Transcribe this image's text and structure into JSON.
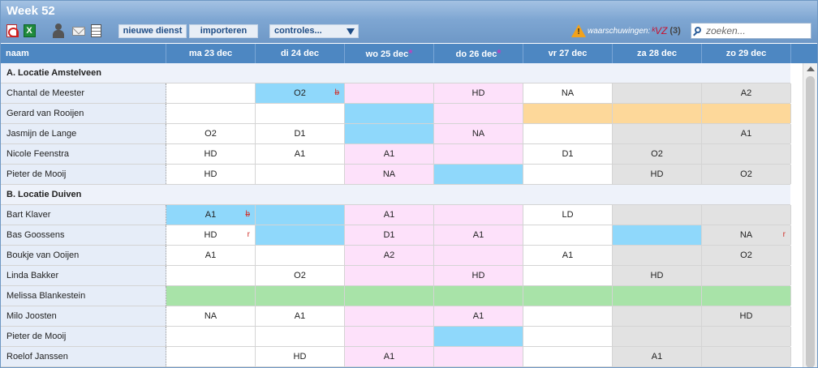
{
  "toolbar": {
    "title": "Week 52",
    "xls_letter": "X",
    "new_shift_label": "nieuwe dienst",
    "import_label": "importeren",
    "checks_label": "controles...",
    "warn_exclamation": "!",
    "warnings_label": "waarschuwingen:",
    "warnings_vz": "ᵏVZ",
    "warnings_count": "(3)",
    "search_placeholder": "zoeken..."
  },
  "colors": {
    "header": "#4d87c2",
    "blue": "#8fd8fb",
    "pink": "#fde1fa",
    "gray": "#e2e2e2",
    "orange": "#fdd89a",
    "green": "#a8e3a8",
    "section_bg": "#eef2fa"
  },
  "columns": {
    "name": "naam",
    "days": [
      {
        "label": "ma 23 dec",
        "star": ""
      },
      {
        "label": "di 24 dec",
        "star": ""
      },
      {
        "label": "wo 25 dec",
        "star": "*"
      },
      {
        "label": "do 26 dec",
        "star": "*"
      },
      {
        "label": "vr 27 dec",
        "star": ""
      },
      {
        "label": "za 28 dec",
        "star": ""
      },
      {
        "label": "zo 29 dec",
        "star": ""
      }
    ]
  },
  "sections": [
    {
      "title": "A. Locatie Amstelveen",
      "rows": [
        {
          "name": "Chantal de Meester",
          "cells": [
            {
              "c": "",
              "bg": "white"
            },
            {
              "c": "O2",
              "bg": "blue",
              "mark": "b",
              "strike": true
            },
            {
              "c": "",
              "bg": "pink"
            },
            {
              "c": "HD",
              "bg": "pink"
            },
            {
              "c": "NA",
              "bg": "white"
            },
            {
              "c": "",
              "bg": "gray"
            },
            {
              "c": "A2",
              "bg": "gray"
            }
          ]
        },
        {
          "name": "Gerard van Rooijen",
          "cells": [
            {
              "c": "",
              "bg": "white"
            },
            {
              "c": "",
              "bg": "white"
            },
            {
              "c": "",
              "bg": "blue"
            },
            {
              "c": "",
              "bg": "pink"
            },
            {
              "c": "",
              "bg": "orange"
            },
            {
              "c": "",
              "bg": "orange"
            },
            {
              "c": "",
              "bg": "orange"
            }
          ]
        },
        {
          "name": "Jasmijn de Lange",
          "cells": [
            {
              "c": "O2",
              "bg": "white"
            },
            {
              "c": "D1",
              "bg": "white"
            },
            {
              "c": "",
              "bg": "blue"
            },
            {
              "c": "NA",
              "bg": "pink"
            },
            {
              "c": "",
              "bg": "white"
            },
            {
              "c": "",
              "bg": "gray"
            },
            {
              "c": "A1",
              "bg": "gray"
            }
          ]
        },
        {
          "name": "Nicole Feenstra",
          "cells": [
            {
              "c": "HD",
              "bg": "white"
            },
            {
              "c": "A1",
              "bg": "white"
            },
            {
              "c": "A1",
              "bg": "pink"
            },
            {
              "c": "",
              "bg": "pink"
            },
            {
              "c": "D1",
              "bg": "white"
            },
            {
              "c": "O2",
              "bg": "gray"
            },
            {
              "c": "",
              "bg": "gray"
            }
          ]
        },
        {
          "name": "Pieter de Mooij",
          "cells": [
            {
              "c": "HD",
              "bg": "white"
            },
            {
              "c": "",
              "bg": "white"
            },
            {
              "c": "NA",
              "bg": "pink"
            },
            {
              "c": "",
              "bg": "blue"
            },
            {
              "c": "",
              "bg": "white"
            },
            {
              "c": "HD",
              "bg": "gray"
            },
            {
              "c": "O2",
              "bg": "gray"
            }
          ]
        }
      ]
    },
    {
      "title": "B. Locatie Duiven",
      "rows": [
        {
          "name": "Bart Klaver",
          "cells": [
            {
              "c": "A1",
              "bg": "blue",
              "mark": "b",
              "strike": true
            },
            {
              "c": "",
              "bg": "blue"
            },
            {
              "c": "A1",
              "bg": "pink"
            },
            {
              "c": "",
              "bg": "pink"
            },
            {
              "c": "LD",
              "bg": "white"
            },
            {
              "c": "",
              "bg": "gray"
            },
            {
              "c": "",
              "bg": "gray"
            }
          ]
        },
        {
          "name": "Bas Goossens",
          "cells": [
            {
              "c": "HD",
              "bg": "white",
              "mark": "r"
            },
            {
              "c": "",
              "bg": "blue"
            },
            {
              "c": "D1",
              "bg": "pink"
            },
            {
              "c": "A1",
              "bg": "pink"
            },
            {
              "c": "",
              "bg": "white"
            },
            {
              "c": "",
              "bg": "blue"
            },
            {
              "c": "NA",
              "bg": "gray",
              "mark": "r"
            }
          ]
        },
        {
          "name": "Boukje van Ooijen",
          "cells": [
            {
              "c": "A1",
              "bg": "white"
            },
            {
              "c": "",
              "bg": "white"
            },
            {
              "c": "A2",
              "bg": "pink"
            },
            {
              "c": "",
              "bg": "pink"
            },
            {
              "c": "A1",
              "bg": "white"
            },
            {
              "c": "",
              "bg": "gray"
            },
            {
              "c": "O2",
              "bg": "gray"
            }
          ]
        },
        {
          "name": "Linda Bakker",
          "cells": [
            {
              "c": "",
              "bg": "white"
            },
            {
              "c": "O2",
              "bg": "white"
            },
            {
              "c": "",
              "bg": "pink"
            },
            {
              "c": "HD",
              "bg": "pink"
            },
            {
              "c": "",
              "bg": "white"
            },
            {
              "c": "HD",
              "bg": "gray"
            },
            {
              "c": "",
              "bg": "gray"
            }
          ]
        },
        {
          "name": "Melissa Blankestein",
          "cells": [
            {
              "c": "",
              "bg": "green"
            },
            {
              "c": "",
              "bg": "green"
            },
            {
              "c": "",
              "bg": "green"
            },
            {
              "c": "",
              "bg": "green"
            },
            {
              "c": "",
              "bg": "green"
            },
            {
              "c": "",
              "bg": "green"
            },
            {
              "c": "",
              "bg": "green"
            }
          ]
        },
        {
          "name": "Milo Joosten",
          "cells": [
            {
              "c": "NA",
              "bg": "white"
            },
            {
              "c": "A1",
              "bg": "white"
            },
            {
              "c": "",
              "bg": "pink"
            },
            {
              "c": "A1",
              "bg": "pink"
            },
            {
              "c": "",
              "bg": "white"
            },
            {
              "c": "",
              "bg": "gray"
            },
            {
              "c": "HD",
              "bg": "gray"
            }
          ]
        },
        {
          "name": "Pieter de Mooij",
          "cells": [
            {
              "c": "",
              "bg": "white"
            },
            {
              "c": "",
              "bg": "white"
            },
            {
              "c": "",
              "bg": "pink"
            },
            {
              "c": "",
              "bg": "blue"
            },
            {
              "c": "",
              "bg": "white"
            },
            {
              "c": "",
              "bg": "gray"
            },
            {
              "c": "",
              "bg": "gray"
            }
          ]
        },
        {
          "name": "Roelof Janssen",
          "cells": [
            {
              "c": "",
              "bg": "white"
            },
            {
              "c": "HD",
              "bg": "white"
            },
            {
              "c": "A1",
              "bg": "pink"
            },
            {
              "c": "",
              "bg": "pink"
            },
            {
              "c": "",
              "bg": "white"
            },
            {
              "c": "A1",
              "bg": "gray"
            },
            {
              "c": "",
              "bg": "gray"
            }
          ]
        }
      ]
    }
  ]
}
